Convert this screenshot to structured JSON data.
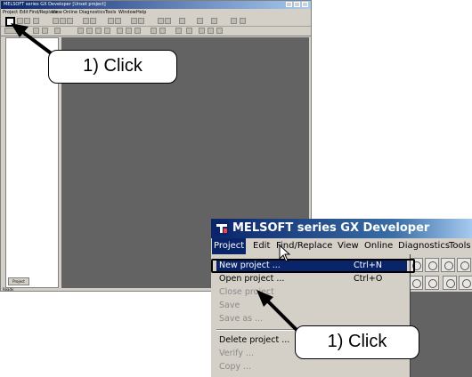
{
  "background_window": {
    "title": "MELSOFT series GX Developer [Unset project]",
    "menu": [
      "Project",
      "Edit",
      "Find/Replace",
      "View",
      "Online",
      "Diagnostics",
      "Tools",
      "Window",
      "Help"
    ],
    "tree_tab": "Project",
    "status": "Ready"
  },
  "zoom_window": {
    "title": "MELSOFT series GX Developer",
    "menu": [
      "Project",
      "Edit",
      "Find/Replace",
      "View",
      "Online",
      "Diagnostics",
      "Tools"
    ],
    "project_menu": {
      "new_project": {
        "label": "New project ...",
        "shortcut": "Ctrl+N"
      },
      "open_project": {
        "label": "Open project ...",
        "shortcut": "Ctrl+O"
      },
      "close_project": {
        "label": "Close project"
      },
      "save": {
        "label": "Save"
      },
      "save_as": {
        "label": "Save as ..."
      },
      "delete_project": {
        "label": "Delete project ..."
      },
      "verify": {
        "label": "Verify ..."
      },
      "copy": {
        "label": "Copy ..."
      }
    }
  },
  "callouts": {
    "top": "1) Click",
    "bottom": "1) Click"
  },
  "colors": {
    "title_bar": "#0a246a",
    "workspace": "#636363",
    "window_face": "#d4d0c8"
  }
}
